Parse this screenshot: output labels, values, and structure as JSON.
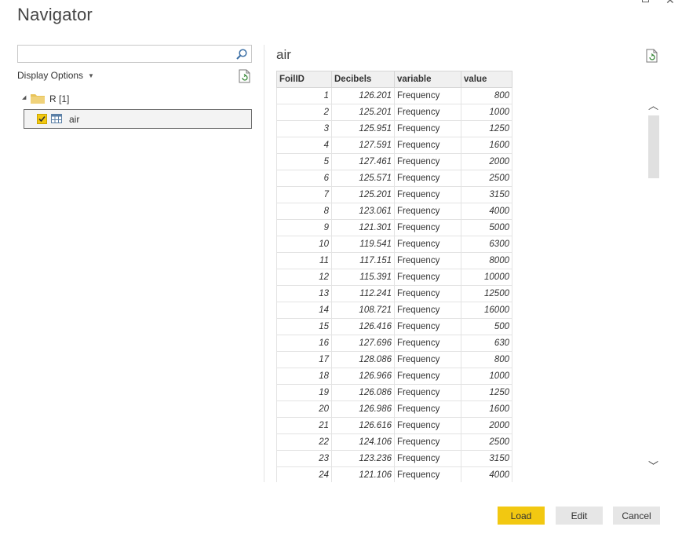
{
  "window": {
    "title": "Navigator"
  },
  "left_panel": {
    "search": {
      "value": "",
      "placeholder": ""
    },
    "display_options_label": "Display Options",
    "tree": {
      "root_label": "R [1]",
      "items": [
        {
          "label": "air",
          "checked": true
        }
      ]
    }
  },
  "preview": {
    "title": "air",
    "columns": [
      "FoilID",
      "Decibels",
      "variable",
      "value"
    ],
    "rows": [
      [
        "1",
        "126.201",
        "Frequency",
        "800"
      ],
      [
        "2",
        "125.201",
        "Frequency",
        "1000"
      ],
      [
        "3",
        "125.951",
        "Frequency",
        "1250"
      ],
      [
        "4",
        "127.591",
        "Frequency",
        "1600"
      ],
      [
        "5",
        "127.461",
        "Frequency",
        "2000"
      ],
      [
        "6",
        "125.571",
        "Frequency",
        "2500"
      ],
      [
        "7",
        "125.201",
        "Frequency",
        "3150"
      ],
      [
        "8",
        "123.061",
        "Frequency",
        "4000"
      ],
      [
        "9",
        "121.301",
        "Frequency",
        "5000"
      ],
      [
        "10",
        "119.541",
        "Frequency",
        "6300"
      ],
      [
        "11",
        "117.151",
        "Frequency",
        "8000"
      ],
      [
        "12",
        "115.391",
        "Frequency",
        "10000"
      ],
      [
        "13",
        "112.241",
        "Frequency",
        "12500"
      ],
      [
        "14",
        "108.721",
        "Frequency",
        "16000"
      ],
      [
        "15",
        "126.416",
        "Frequency",
        "500"
      ],
      [
        "16",
        "127.696",
        "Frequency",
        "630"
      ],
      [
        "17",
        "128.086",
        "Frequency",
        "800"
      ],
      [
        "18",
        "126.966",
        "Frequency",
        "1000"
      ],
      [
        "19",
        "126.086",
        "Frequency",
        "1250"
      ],
      [
        "20",
        "126.986",
        "Frequency",
        "1600"
      ],
      [
        "21",
        "126.616",
        "Frequency",
        "2000"
      ],
      [
        "22",
        "124.106",
        "Frequency",
        "2500"
      ],
      [
        "23",
        "123.236",
        "Frequency",
        "3150"
      ],
      [
        "24",
        "121.106",
        "Frequency",
        "4000"
      ]
    ]
  },
  "footer": {
    "load_label": "Load",
    "edit_label": "Edit",
    "cancel_label": "Cancel"
  },
  "colors": {
    "accent": "#f2c811",
    "button_gray": "#e6e6e6"
  },
  "icons": {
    "search": "search-icon",
    "refresh": "refresh-icon",
    "folder": "folder-icon",
    "table": "table-icon",
    "expand": "expand-arrow-icon"
  }
}
